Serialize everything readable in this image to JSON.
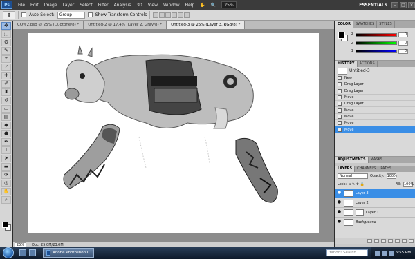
{
  "menubar": {
    "logo": "Ps",
    "items": [
      "File",
      "Edit",
      "Image",
      "Layer",
      "Select",
      "Filter",
      "Analysis",
      "3D",
      "View",
      "Window",
      "Help"
    ],
    "zoom": "25%",
    "workspace": "ESSENTIALS"
  },
  "options": {
    "auto_select_label": "Auto-Select:",
    "auto_select_value": "Group",
    "transform_label": "Show Transform Controls"
  },
  "tabs": [
    {
      "label": "COW2.psd @ 25% (Duotone/8) *"
    },
    {
      "label": "Untitled-2 @ 17.4% (Layer 2, Gray/8) *"
    },
    {
      "label": "Untitled-3 @ 25% (Layer 3, RGB/8) *"
    }
  ],
  "status": {
    "zoom": "25%",
    "doc": "Doc: 25.0M/23.0M"
  },
  "color_panel": {
    "tabs": [
      "COLOR",
      "SWATCHES",
      "STYLES"
    ],
    "r": "0",
    "g": "0",
    "b": "0"
  },
  "history_panel": {
    "tabs": [
      "HISTORY",
      "ACTIONS"
    ],
    "snapshot": "Untitled-3",
    "items": [
      "New",
      "Drag Layer",
      "Drag Layer",
      "Move",
      "Drag Layer",
      "Move",
      "Move",
      "Move",
      "Move"
    ]
  },
  "adjust_tabs": [
    "ADJUSTMENTS",
    "MASKS"
  ],
  "layers_panel": {
    "tabs": [
      "LAYERS",
      "CHANNELS",
      "PATHS"
    ],
    "blend_mode": "Normal",
    "opacity_label": "Opacity:",
    "opacity": "100%",
    "lock_label": "Lock:",
    "fill_label": "Fill:",
    "fill": "100%",
    "layers": [
      {
        "name": "Layer 3"
      },
      {
        "name": "Layer 2"
      },
      {
        "name": "Layer 1"
      },
      {
        "name": "Background"
      }
    ]
  },
  "taskbar": {
    "task_label": "Adobe Photoshop C...",
    "search_placeholder": "Yahoo! Search",
    "time": "6:55 PM"
  },
  "colors": {
    "selection_blue": "#3a8ee6",
    "menubar_bg": "#3b3b3b"
  }
}
